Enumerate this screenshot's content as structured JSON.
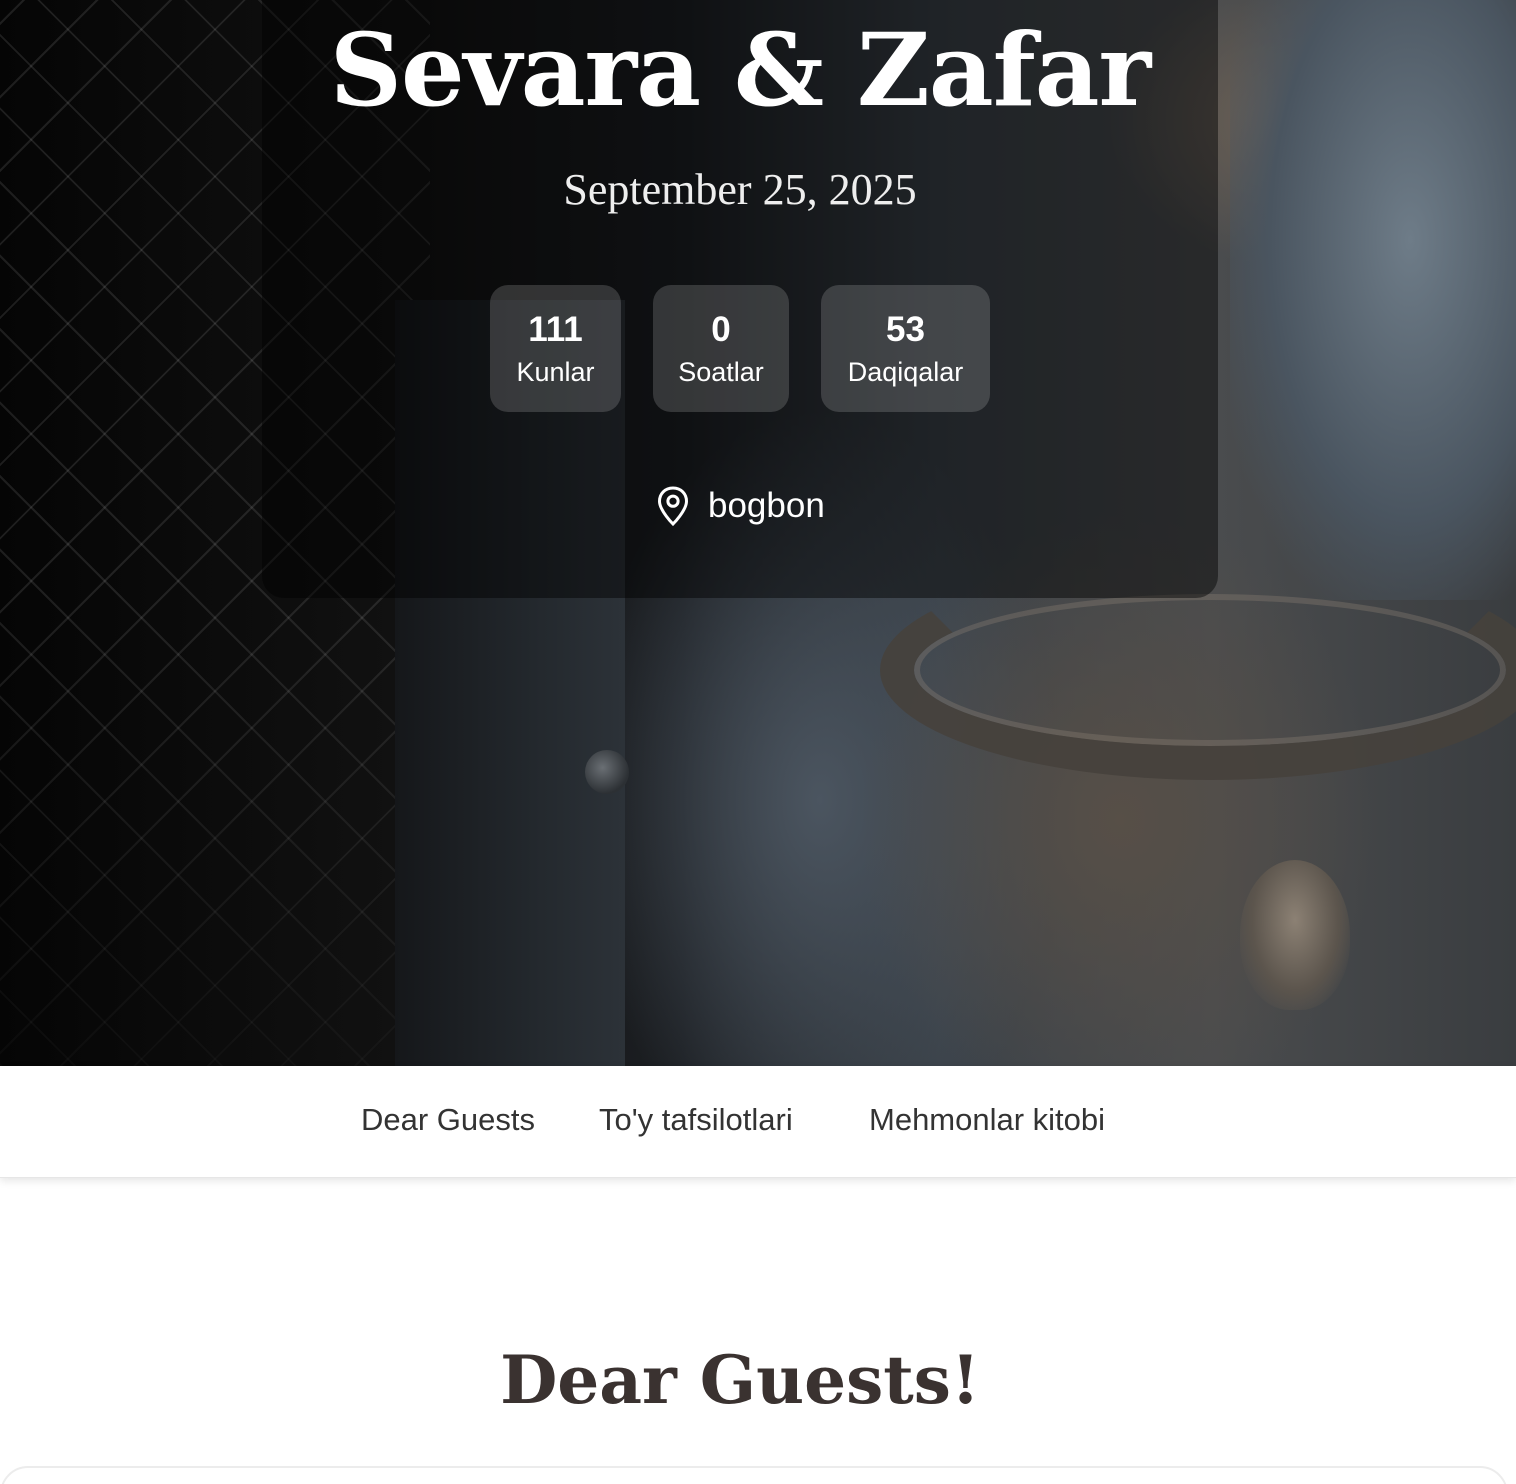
{
  "hero": {
    "names": "Sevara & Zafar",
    "date": "September 25, 2025",
    "countdown": [
      {
        "value": "111",
        "label": "Kunlar"
      },
      {
        "value": "0",
        "label": "Soatlar"
      },
      {
        "value": "53",
        "label": "Daqiqalar"
      }
    ],
    "location_icon": "map-pin-icon",
    "location": "bogbon"
  },
  "nav": {
    "items": [
      {
        "label": "Dear Guests"
      },
      {
        "label": "To'y tafsilotlari"
      },
      {
        "label": "Mehmonlar kitobi"
      }
    ]
  },
  "section": {
    "title": "Dear Guests!"
  },
  "colors": {
    "overlay": "#000000",
    "text_dark": "#3a3230",
    "nav_text": "#333333"
  }
}
